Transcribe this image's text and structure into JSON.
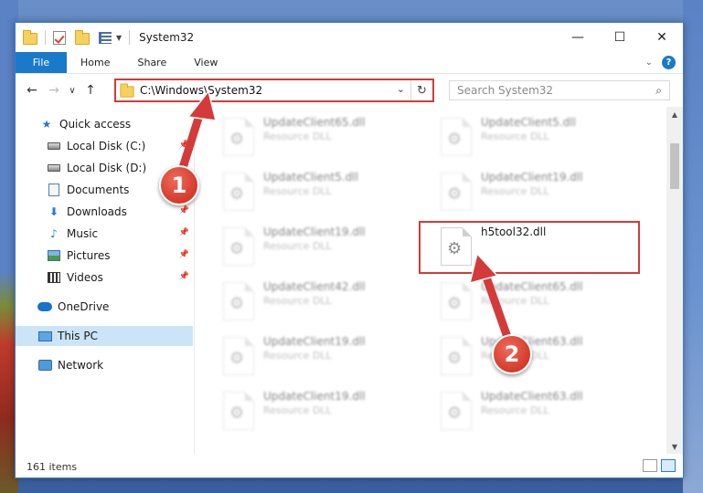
{
  "window": {
    "title": "System32",
    "controls": {
      "minimize": "—",
      "maximize": "☐",
      "close": "✕"
    }
  },
  "ribbon": {
    "tabs": [
      {
        "label": "File",
        "active": true
      },
      {
        "label": "Home"
      },
      {
        "label": "Share"
      },
      {
        "label": "View"
      }
    ],
    "help": "?"
  },
  "nav": {
    "back": "←",
    "forward": "→",
    "recent": "∨",
    "up": "↑",
    "address": "C:\\Windows\\System32",
    "refresh": "↻",
    "search_placeholder": "Search System32"
  },
  "sidebar": {
    "items": [
      {
        "label": "Quick access",
        "icon": "star-icon"
      },
      {
        "label": "Local Disk (C:)",
        "icon": "disk-icon",
        "pinned": true
      },
      {
        "label": "Local Disk (D:)",
        "icon": "disk-icon",
        "pinned": true
      },
      {
        "label": "Documents",
        "icon": "document-icon",
        "pinned": true
      },
      {
        "label": "Downloads",
        "icon": "download-icon",
        "pinned": true
      },
      {
        "label": "Music",
        "icon": "music-icon",
        "pinned": true
      },
      {
        "label": "Pictures",
        "icon": "pictures-icon",
        "pinned": true
      },
      {
        "label": "Videos",
        "icon": "videos-icon",
        "pinned": true
      },
      {
        "label": "OneDrive",
        "icon": "cloud-icon"
      },
      {
        "label": "This PC",
        "icon": "pc-icon",
        "selected": true
      },
      {
        "label": "Network",
        "icon": "network-icon"
      }
    ]
  },
  "files": {
    "left": [
      {
        "name": "UpdateClient65.dll",
        "type": "Resource DLL"
      },
      {
        "name": "UpdateClient5.dll",
        "type": "Resource DLL"
      },
      {
        "name": "UpdateClient19.dll",
        "type": "Resource DLL"
      },
      {
        "name": "UpdateClient42.dll",
        "type": "Resource DLL"
      },
      {
        "name": "UpdateClient19.dll",
        "type": "Resource DLL"
      },
      {
        "name": "UpdateClient19.dll",
        "type": "Resource DLL"
      }
    ],
    "right": [
      {
        "name": "UpdateClient5.dll",
        "type": "Resource DLL"
      },
      {
        "name": "UpdateClient19.dll",
        "type": "Resource DLL"
      },
      {
        "name": "h5tool32.dll",
        "type": ""
      },
      {
        "name": "UpdateClient65.dll",
        "type": "Resource DLL"
      },
      {
        "name": "UpdateClient63.dll",
        "type": "Resource DLL"
      },
      {
        "name": "UpdateClient63.dll",
        "type": "Resource DLL"
      }
    ]
  },
  "status": {
    "item_count": "161 items"
  },
  "annotations": {
    "step1": "1",
    "step2": "2",
    "color": "#d43a3a"
  }
}
